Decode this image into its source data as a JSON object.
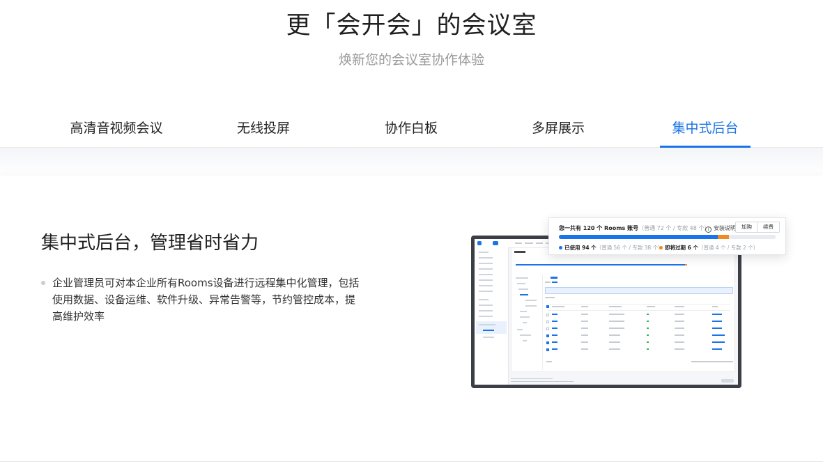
{
  "hero": {
    "title": "更「会开会」的会议室",
    "subtitle": "焕新您的会议室协作体验"
  },
  "tabs": [
    {
      "label": "高清音视频会议",
      "active": false
    },
    {
      "label": "无线投屏",
      "active": false
    },
    {
      "label": "协作白板",
      "active": false
    },
    {
      "label": "多屏展示",
      "active": false
    },
    {
      "label": "集中式后台",
      "active": true
    }
  ],
  "feature": {
    "title": "集中式后台，管理省时省力",
    "bullets": [
      "企业管理员可对本企业所有Rooms设备进行远程集中化管理，包括使用数据、设备运维、软件升级、异常告警等，节约管控成本，提高维护效率"
    ]
  },
  "overlay": {
    "summary_prefix": "您一共有 120 个 Rooms 账号",
    "summary_detail": "（普通 72 个 / 专款 48 个）",
    "install_label": "安装说明",
    "buy_label": "加购",
    "renew_label": "续费",
    "used_label": "已使用 94 个",
    "used_detail": "（普通 56 个 / 专款 38 个）",
    "expiring_label": "即将过期 6 个",
    "expiring_detail": "（普通 4 个 / 专款 2 个）",
    "total": 120,
    "used": 94,
    "expiring": 6
  },
  "colors": {
    "accent": "#1a73e8",
    "warning": "#f08a24",
    "muted_text": "#9a9a9a"
  },
  "icons": {
    "info": "info-circle-icon",
    "bullet": "bullet-dot-icon"
  }
}
